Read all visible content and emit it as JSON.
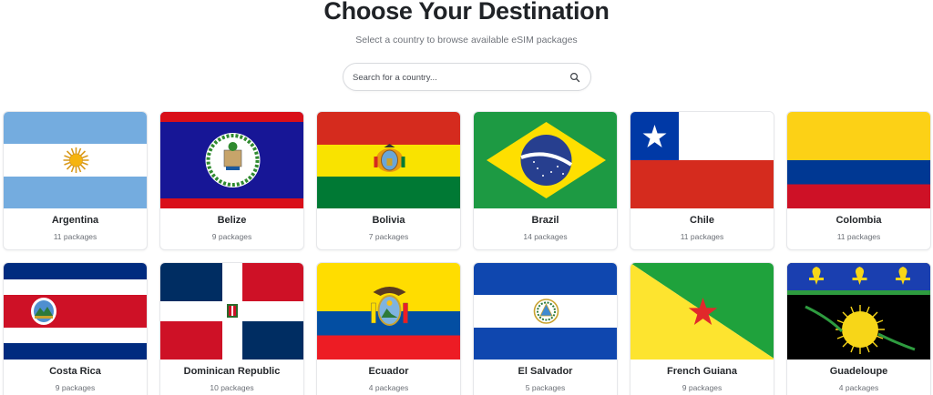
{
  "header": {
    "title": "Choose Your Destination",
    "subtitle": "Select a country to browse available eSIM packages"
  },
  "search": {
    "placeholder": "Search for a country...",
    "icon": "search-icon"
  },
  "countries": [
    {
      "name": "Argentina",
      "packages": "11 packages"
    },
    {
      "name": "Belize",
      "packages": "9 packages"
    },
    {
      "name": "Bolivia",
      "packages": "7 packages"
    },
    {
      "name": "Brazil",
      "packages": "14 packages"
    },
    {
      "name": "Chile",
      "packages": "11 packages"
    },
    {
      "name": "Colombia",
      "packages": "11 packages"
    },
    {
      "name": "Costa Rica",
      "packages": "9 packages"
    },
    {
      "name": "Dominican Republic",
      "packages": "10 packages"
    },
    {
      "name": "Ecuador",
      "packages": "4 packages"
    },
    {
      "name": "El Salvador",
      "packages": "5 packages"
    },
    {
      "name": "French Guiana",
      "packages": "9 packages"
    },
    {
      "name": "Guadeloupe",
      "packages": "4 packages"
    }
  ],
  "colors": {
    "title": "#202327",
    "subtitle": "#6f737a",
    "card_border": "#e6e7ea"
  }
}
